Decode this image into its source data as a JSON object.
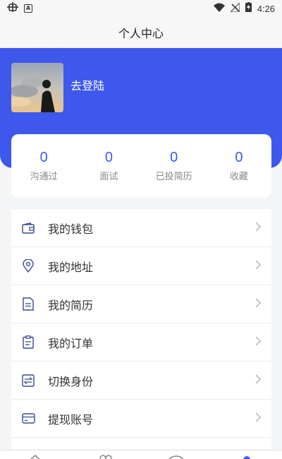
{
  "status_bar": {
    "time": "4:26",
    "left_icons": [
      "bug-icon",
      "a-box-icon"
    ],
    "right_icons": [
      "wifi-icon",
      "no-signal-icon",
      "battery-charging-icon"
    ],
    "a_label": "A"
  },
  "header": {
    "title": "个人中心"
  },
  "profile": {
    "login_label": "去登陆"
  },
  "stats": [
    {
      "value": "0",
      "label": "沟通过"
    },
    {
      "value": "0",
      "label": "面试"
    },
    {
      "value": "0",
      "label": "已投简历"
    },
    {
      "value": "0",
      "label": "收藏"
    }
  ],
  "menu": [
    {
      "label": "我的钱包",
      "icon": "wallet-icon"
    },
    {
      "label": "我的地址",
      "icon": "location-pin-icon"
    },
    {
      "label": "我的简历",
      "icon": "document-icon"
    },
    {
      "label": "我的订单",
      "icon": "clipboard-icon"
    },
    {
      "label": "切换身份",
      "icon": "switch-icon"
    },
    {
      "label": "提现账号",
      "icon": "card-icon"
    }
  ],
  "colors": {
    "accent": "#3d58ea",
    "icon": "#3b4a8f"
  },
  "tabbar": {
    "icons": [
      "home-icon",
      "contacts-icon",
      "message-icon",
      "profile-icon"
    ],
    "active_index": 3
  }
}
